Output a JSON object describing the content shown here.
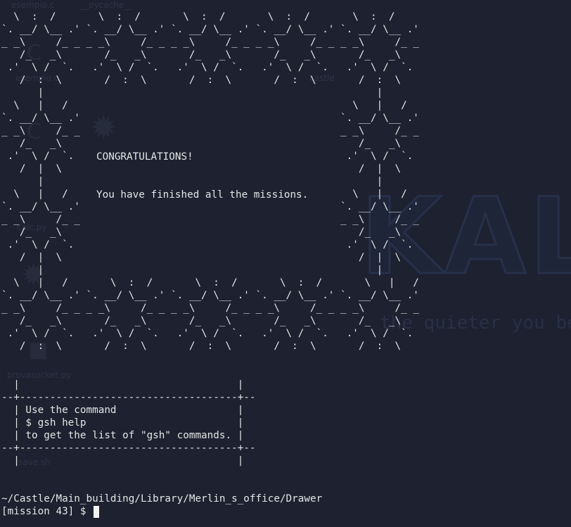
{
  "desktop": {
    "files": [
      {
        "name": "esempio.c"
      },
      {
        "name": "__pycache__"
      },
      {
        "name": "esempio.c"
      },
      {
        "name": "calc.py"
      },
      {
        "name": "castle"
      },
      {
        "name": "provasocket.py"
      },
      {
        "name": "save.sh"
      }
    ],
    "wallpaper_logo": "KALI",
    "wallpaper_tagline": "the quieter you become"
  },
  "terminal": {
    "ascii_frame": "  \\  :  /       \\  :  /       \\  :  /       \\  :  /       \\  :  /\n`. __/ \\__ .' `. __/ \\__ .' `. __/ \\__ .' `. __/ \\__ .' `. __/ \\__ .'\n_ _\\     /_ _ _ _\\     /_ _ _ _\\     /_ _ _ _\\     /_ _ _ _\\     /_ _\n   /_   _\\       /_   _\\       /_   _\\       /_   _\\       /_   _\\\n .'  \\ /  `.   .'  \\ /  `.   .'  \\ /  `.   .'  \\ /  `.   .'  \\ /  `.\n   /  :  \\       /  :  \\       /  :  \\       /  :  \\       /  :  \\\n      |                                                       |\n  \\   |   /                                               \\   |   /\n`. __/ \\__ .'                                           `. __/ \\__ .'\n_ _\\     /_ _                                           _ _\\     /_ _\n   /_   _\\                                                 /_   _\\\n .'  \\ /  `.                                             .'  \\ /  `.\n   /  |  \\                                                 /  |  \\\n      |                                                       |\n  \\   |   /                                               \\   |   /\n`. __/ \\__ .'                                           `. __/ \\__ .'\n_ _\\     /_ _                                           _ _\\     /_ _\n   /_   _\\                                                 /_   _\\\n .'  \\ /  `.                                             .'  \\ /  `.\n   /  |  \\                                                 /  |  \\\n      |                                                       |\n  \\   |   /       \\  :  /       \\  :  /       \\  :  /       \\   |   /\n`. __/ \\__ .' `. __/ \\__ .' `. __/ \\__ .' `. __/ \\__ .' `. __/ \\__ .'\n_ _\\     /_ _ _ _\\     /_ _ _ _\\     /_ _ _ _\\     /_ _ _ _\\     /_ _\n   /_   _\\       /_   _\\       /_   _\\       /_   _\\       /_   _\\\n .'  \\ /  `.   .'  \\ /  `.   .'  \\ /  `.   .'  \\ /  `.   .'  \\ /  `.\n   /  :  \\       /  :  \\       /  :  \\       /  :  \\       /  :  \\",
    "message_title": "CONGRATULATIONS!",
    "message_body": "You have finished all the missions.",
    "help_box": "  |                                    |\n--+------------------------------------+--\n  | Use the command                    |\n  | $ gsh help                         |\n  | to get the list of \"gsh\" commands. |\n--+------------------------------------+--\n  |                                    |",
    "cwd": "~/Castle/Main_building/Library/Merlin_s_office/Drawer",
    "prompt": "[mission 43] $ "
  },
  "colors": {
    "terminal_background": "#1d2130",
    "terminal_text": "#e6e6e6",
    "cursor": "#f2f2f2"
  }
}
